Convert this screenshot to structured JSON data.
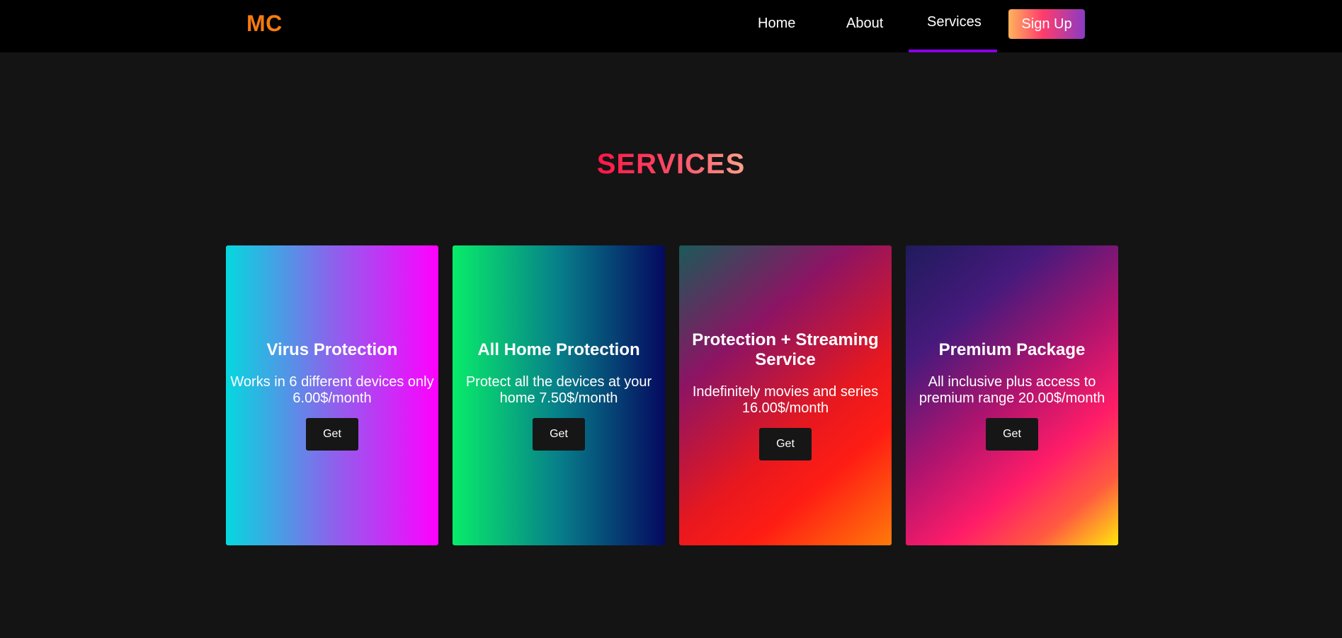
{
  "navbar": {
    "logo": "MC",
    "links": [
      {
        "label": "Home"
      },
      {
        "label": "About"
      },
      {
        "label": "Services",
        "active": true
      }
    ],
    "signup_label": "Sign Up"
  },
  "section": {
    "title": "SERVICES"
  },
  "cards": [
    {
      "title": "Virus Protection",
      "text": "Works in 6 different devices only 6.00$/month",
      "button": "Get"
    },
    {
      "title": "All Home Protection",
      "text": "Protect all the devices at your home 7.50$/month",
      "button": "Get"
    },
    {
      "title": "Protection + Streaming Service",
      "text": "Indefinitely movies and series 16.00$/month",
      "button": "Get"
    },
    {
      "title": "Premium Package",
      "text": "All inclusive plus access to premium range 20.00$/month",
      "button": "Get"
    }
  ],
  "colors": {
    "logo": "#f77b0f",
    "active_underline": "#8a00e6",
    "navbar_bg": "#000000",
    "page_bg": "#141414"
  }
}
